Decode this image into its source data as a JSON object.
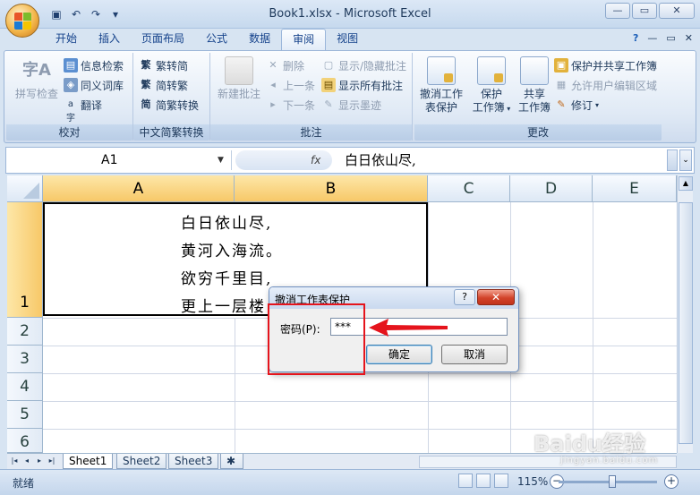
{
  "window": {
    "title": "Book1.xlsx - Microsoft Excel",
    "controls": [
      "—",
      "▭",
      "✕"
    ]
  },
  "quick_access": [
    "save-icon",
    "undo-icon",
    "redo-icon",
    "customize-icon"
  ],
  "tabs": [
    {
      "label": "开始"
    },
    {
      "label": "插入"
    },
    {
      "label": "页面布局"
    },
    {
      "label": "公式"
    },
    {
      "label": "数据"
    },
    {
      "label": "审阅",
      "active": true
    },
    {
      "label": "视图"
    }
  ],
  "ribbon_right": {
    "help": "?",
    "min": "—",
    "restore": "▭",
    "close": "✕"
  },
  "groups": {
    "proofing": {
      "label": "校对",
      "spellcheck": "拼写检查",
      "research": "信息检索",
      "thesaurus": "同义词库",
      "translate": "翻译"
    },
    "chinese": {
      "label": "中文简繁转换",
      "to_simplified": "繁转简",
      "to_traditional": "简转繁",
      "convert": "简繁转换"
    },
    "comments": {
      "label": "批注",
      "new": "新建批注",
      "delete": "删除",
      "previous": "上一条",
      "next": "下一条",
      "show_hide": "显示/隐藏批注",
      "show_all": "显示所有批注",
      "show_ink": "显示墨迹"
    },
    "changes": {
      "label": "更改",
      "unprotect_sheet_1": "撤消工作",
      "unprotect_sheet_2": "表保护",
      "protect_workbook_1": "保护",
      "protect_workbook_2": "工作簿",
      "share_workbook_1": "共享",
      "share_workbook_2": "工作簿",
      "protect_share": "保护并共享工作簿",
      "allow_edit": "允许用户编辑区域",
      "track": "修订"
    }
  },
  "formula_bar": {
    "name_box": "A1",
    "fx": "fx",
    "content": "白日依山尽,"
  },
  "columns": [
    "A",
    "B",
    "C",
    "D",
    "E"
  ],
  "rows": [
    "1",
    "2",
    "3",
    "4",
    "5",
    "6"
  ],
  "poem": [
    "白日依山尽,",
    "黄河入海流。",
    "欲穷千里目,",
    "更上一层楼"
  ],
  "dialog": {
    "title": "撤消工作表保护",
    "help": "?",
    "close": "✕",
    "password_label": "密码(P):",
    "password_value": "***",
    "ok": "确定",
    "cancel": "取消"
  },
  "sheets": [
    {
      "name": "Sheet1",
      "active": true
    },
    {
      "name": "Sheet2"
    },
    {
      "name": "Sheet3"
    }
  ],
  "status": {
    "mode": "就绪",
    "zoom": "115%",
    "zoom_out": "−",
    "zoom_in": "+"
  },
  "watermark": {
    "text": "Baidu经验",
    "sub": "jingyan.baidu.com"
  },
  "colors": {
    "accent": "#f7c868",
    "highlight_red": "#e5141c",
    "ribbon_text": "#1e395b"
  }
}
